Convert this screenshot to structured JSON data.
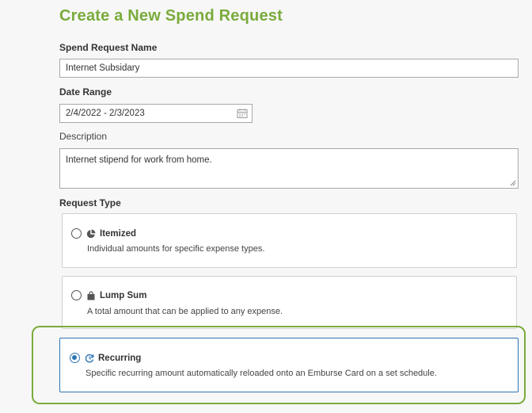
{
  "page": {
    "title": "Create a New Spend Request"
  },
  "form": {
    "name_label": "Spend Request Name",
    "name_value": "Internet Subsidary",
    "date_label": "Date Range",
    "date_value": "2/4/2022 - 2/3/2023",
    "description_label": "Description",
    "description_value": "Internet stipend for work from home.",
    "request_type_label": "Request Type"
  },
  "request_types": [
    {
      "title": "Itemized",
      "description": "Individual amounts for specific expense types.",
      "icon": "pie-chart-icon",
      "selected": false
    },
    {
      "title": "Lump Sum",
      "description": "A total amount that can be applied to any expense.",
      "icon": "shopping-bag-icon",
      "selected": false
    },
    {
      "title": "Recurring",
      "description": "Specific recurring amount automatically reloaded onto an Emburse Card on a set schedule.",
      "icon": "recurring-icon",
      "selected": true
    }
  ],
  "colors": {
    "accent_green": "#7aab3c",
    "selected_blue": "#2e74b5"
  }
}
